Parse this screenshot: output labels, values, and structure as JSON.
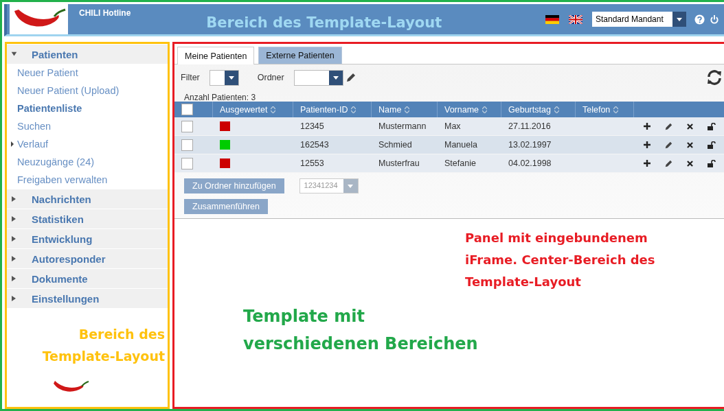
{
  "header": {
    "product": "CHILI Hotline",
    "title": "Bereich des Template-Layout",
    "mandant": "Standard Mandant"
  },
  "sidebar": {
    "groups": [
      {
        "label": "Patienten",
        "expanded": true,
        "items": [
          {
            "label": "Neuer Patient",
            "kind": "link",
            "selected": false
          },
          {
            "label": "Neuer Patient (Upload)",
            "kind": "link",
            "selected": false
          },
          {
            "label": "Patientenliste",
            "kind": "link",
            "selected": true
          },
          {
            "label": "Suchen",
            "kind": "link",
            "selected": false
          },
          {
            "label": "Verlauf",
            "kind": "folder",
            "selected": false
          },
          {
            "label": "Neuzugänge (24)",
            "kind": "link",
            "selected": false
          },
          {
            "label": "Freigaben verwalten",
            "kind": "link",
            "selected": false
          }
        ]
      },
      {
        "label": "Nachrichten",
        "expanded": false
      },
      {
        "label": "Statistiken",
        "expanded": false
      },
      {
        "label": "Entwicklung",
        "expanded": false
      },
      {
        "label": "Autoresponder",
        "expanded": false
      },
      {
        "label": "Dokumente",
        "expanded": false
      },
      {
        "label": "Einstellungen",
        "expanded": false
      }
    ],
    "note": [
      "Bereich des",
      "Template-Layout"
    ]
  },
  "tabs": [
    {
      "label": "Meine Patienten",
      "selected": true
    },
    {
      "label": "Externe Patienten",
      "selected": false
    }
  ],
  "toolbar": {
    "filter_label": "Filter",
    "folder_label": "Ordner"
  },
  "count": "Anzahl Patienten: 3",
  "table": {
    "all_checked": false,
    "columns": [
      "Ausgewertet",
      "Patienten-ID",
      "Name",
      "Vorname",
      "Geburtstag",
      "Telefon"
    ],
    "rows": [
      {
        "checked": false,
        "color": "#cc0000",
        "id": "12345",
        "name": "Mustermann",
        "vorname": "Max",
        "geburtstag": "27.11.2016"
      },
      {
        "checked": false,
        "color": "#00cc00",
        "id": "162543",
        "name": "Schmied",
        "vorname": "Manuela",
        "geburtstag": "13.02.1997"
      },
      {
        "checked": false,
        "color": "#cc0000",
        "id": "12553",
        "name": "Musterfrau",
        "vorname": "Stefanie",
        "geburtstag": "04.02.1998"
      }
    ]
  },
  "actions": {
    "add_button": {
      "label": "Zu Ordner hinzufügen",
      "disabled": true
    },
    "folder_select": {
      "value": "12341234",
      "disabled": true
    },
    "merge_button": {
      "label": "Zusammenführen",
      "disabled": true
    }
  },
  "panel_note": [
    "Panel mit eingebundenem",
    "iFrame. Center-Bereich des",
    "Template-Layout"
  ],
  "template_note": [
    "Template mit",
    "verschiedenen Bereichen"
  ]
}
